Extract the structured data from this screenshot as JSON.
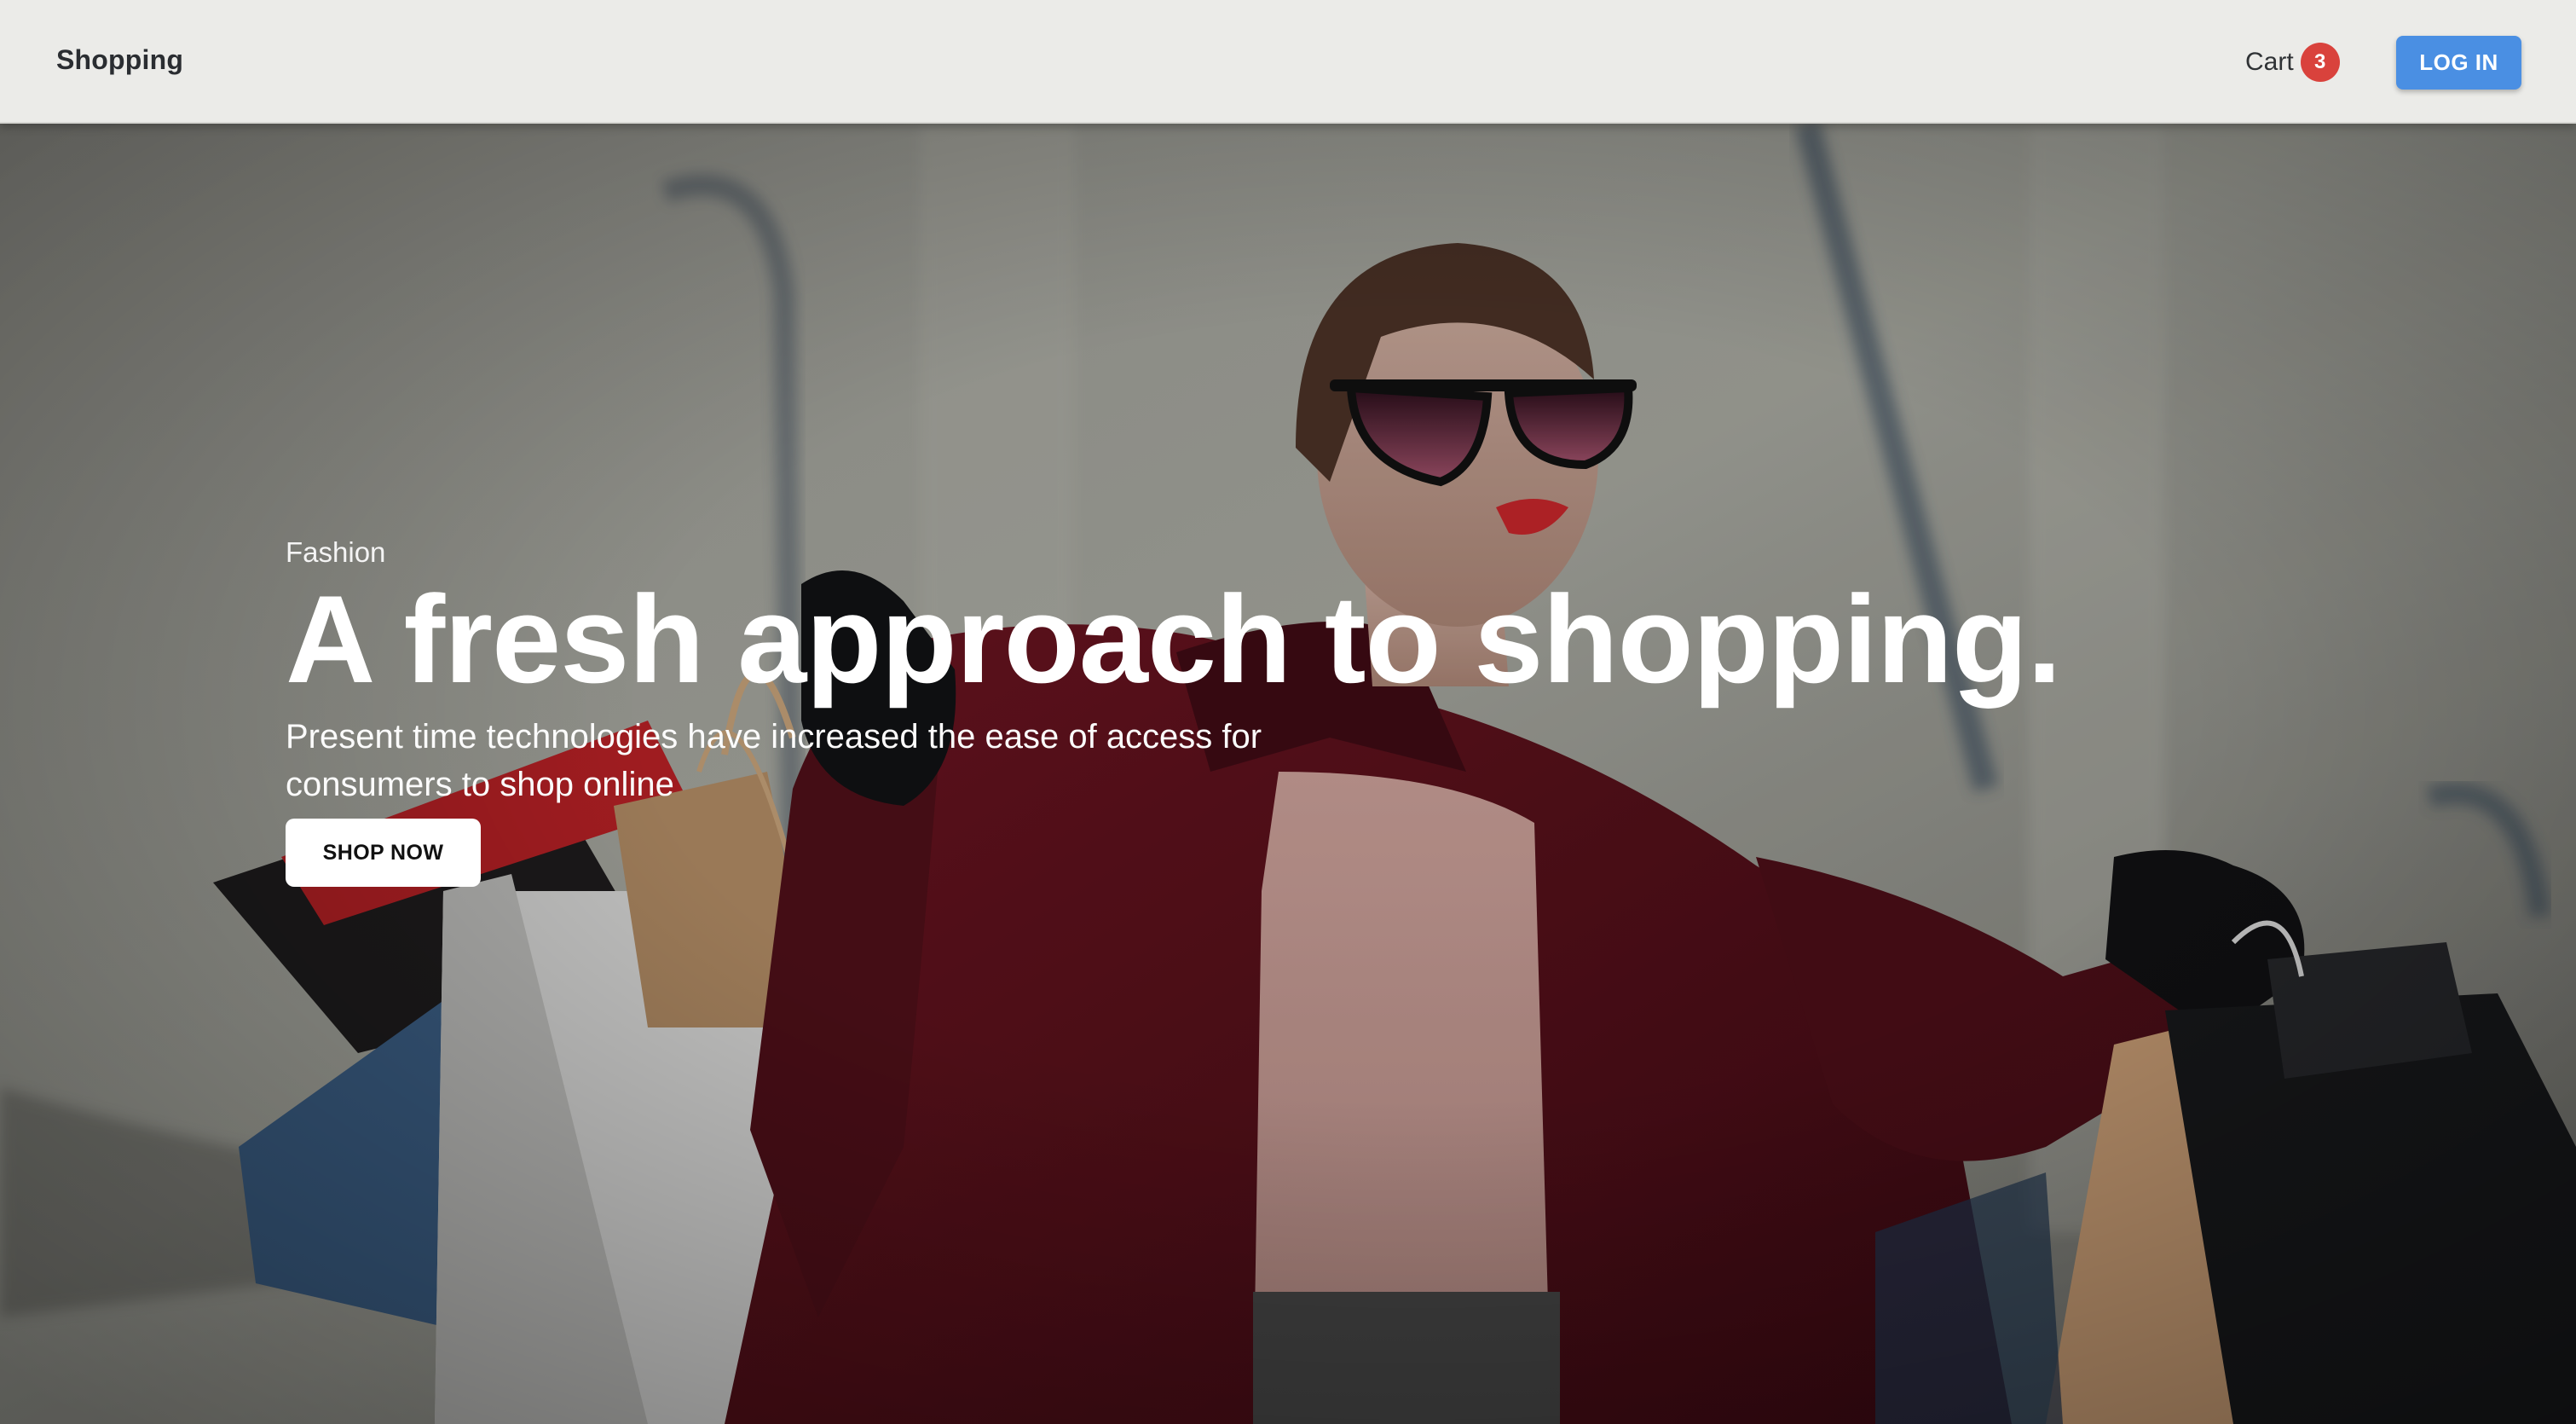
{
  "header": {
    "brand": "Shopping",
    "cart_label": "Cart",
    "cart_count": "3",
    "login_label": "LOG IN"
  },
  "hero": {
    "eyebrow": "Fashion",
    "headline": "A fresh approach to shopping.",
    "subtext": "Present time technologies have increased the ease of access for consumers to shop online",
    "cta_label": "SHOP NOW",
    "image": "woman-with-shopping-bags"
  },
  "colors": {
    "header_bg": "#ebebe8",
    "login_button": "#4a8fe3",
    "cart_badge": "#d9423c",
    "hero_text": "#ffffff"
  }
}
